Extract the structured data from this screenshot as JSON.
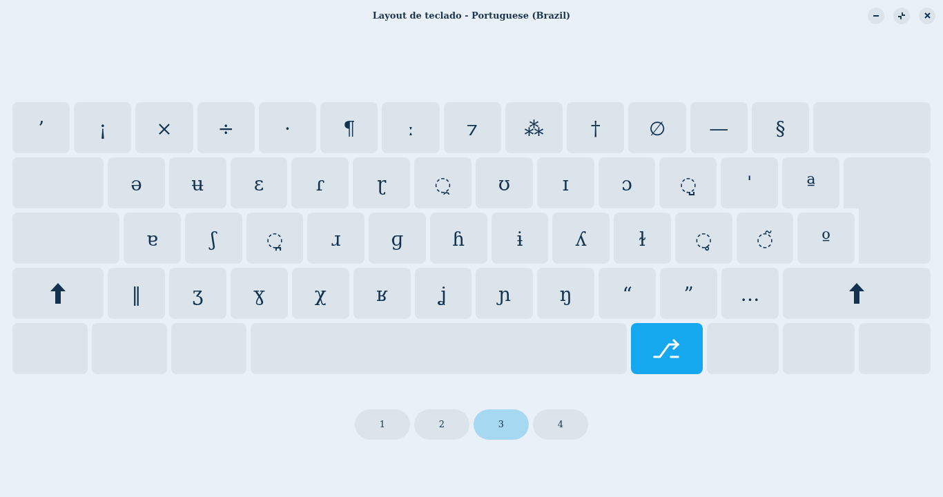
{
  "window": {
    "title": "Layout de teclado - Portuguese (Brazil)"
  },
  "keyboard": {
    "rows": [
      {
        "keys": [
          {
            "kind": "char",
            "label": "’"
          },
          {
            "kind": "char",
            "label": "¡"
          },
          {
            "kind": "char",
            "label": "×"
          },
          {
            "kind": "char",
            "label": "÷"
          },
          {
            "kind": "char",
            "label": "·"
          },
          {
            "kind": "char",
            "label": "¶"
          },
          {
            "kind": "char",
            "label": "ː"
          },
          {
            "kind": "char",
            "label": "⁊"
          },
          {
            "kind": "char",
            "label": "⁂"
          },
          {
            "kind": "char",
            "label": "†"
          },
          {
            "kind": "char",
            "label": "∅"
          },
          {
            "kind": "char",
            "label": "—"
          },
          {
            "kind": "char",
            "label": "§"
          },
          {
            "kind": "blank"
          }
        ]
      },
      {
        "keys": [
          {
            "kind": "blank"
          },
          {
            "kind": "char",
            "label": "ə"
          },
          {
            "kind": "char",
            "label": "ʉ"
          },
          {
            "kind": "char",
            "label": "ɛ"
          },
          {
            "kind": "char",
            "label": "ɾ"
          },
          {
            "kind": "char",
            "label": "ɽ"
          },
          {
            "kind": "char",
            "label": "◌̯"
          },
          {
            "kind": "char",
            "label": "ʊ"
          },
          {
            "kind": "char",
            "label": "ɪ"
          },
          {
            "kind": "char",
            "label": "ɔ"
          },
          {
            "kind": "char",
            "label": "◌̺"
          },
          {
            "kind": "char",
            "label": "ˈ"
          },
          {
            "kind": "char",
            "label": "ª"
          },
          {
            "kind": "enter"
          }
        ]
      },
      {
        "keys": [
          {
            "kind": "blank"
          },
          {
            "kind": "char",
            "label": "ɐ"
          },
          {
            "kind": "char",
            "label": "ʃ"
          },
          {
            "kind": "char",
            "label": "◌̪"
          },
          {
            "kind": "char",
            "label": "ɹ"
          },
          {
            "kind": "char",
            "label": "ɡ"
          },
          {
            "kind": "char",
            "label": "ɦ"
          },
          {
            "kind": "char",
            "label": "ɨ"
          },
          {
            "kind": "char",
            "label": "ʎ"
          },
          {
            "kind": "char",
            "label": "ɫ"
          },
          {
            "kind": "char",
            "label": "◌̥"
          },
          {
            "kind": "char",
            "label": "◌̃"
          },
          {
            "kind": "char",
            "label": "º"
          }
        ]
      },
      {
        "keys": [
          {
            "kind": "shift",
            "latched": false
          },
          {
            "kind": "char",
            "label": "‖"
          },
          {
            "kind": "char",
            "label": "ʒ"
          },
          {
            "kind": "char",
            "label": "ɣ"
          },
          {
            "kind": "char",
            "label": "χ"
          },
          {
            "kind": "char",
            "label": "ʁ"
          },
          {
            "kind": "char",
            "label": "ʝ"
          },
          {
            "kind": "char",
            "label": "ɲ"
          },
          {
            "kind": "char",
            "label": "ŋ"
          },
          {
            "kind": "char",
            "label": "“"
          },
          {
            "kind": "char",
            "label": "”"
          },
          {
            "kind": "char",
            "label": "…"
          },
          {
            "kind": "shift",
            "latched": false
          }
        ]
      },
      {
        "keys": [
          {
            "kind": "blank"
          },
          {
            "kind": "blank"
          },
          {
            "kind": "blank"
          },
          {
            "kind": "space"
          },
          {
            "kind": "switch",
            "latched": true
          },
          {
            "kind": "blank"
          },
          {
            "kind": "blank"
          },
          {
            "kind": "blank"
          }
        ]
      }
    ]
  },
  "pages": [
    {
      "label": "1",
      "selected": false
    },
    {
      "label": "2",
      "selected": false
    },
    {
      "label": "3",
      "selected": true
    },
    {
      "label": "4",
      "selected": false
    }
  ]
}
